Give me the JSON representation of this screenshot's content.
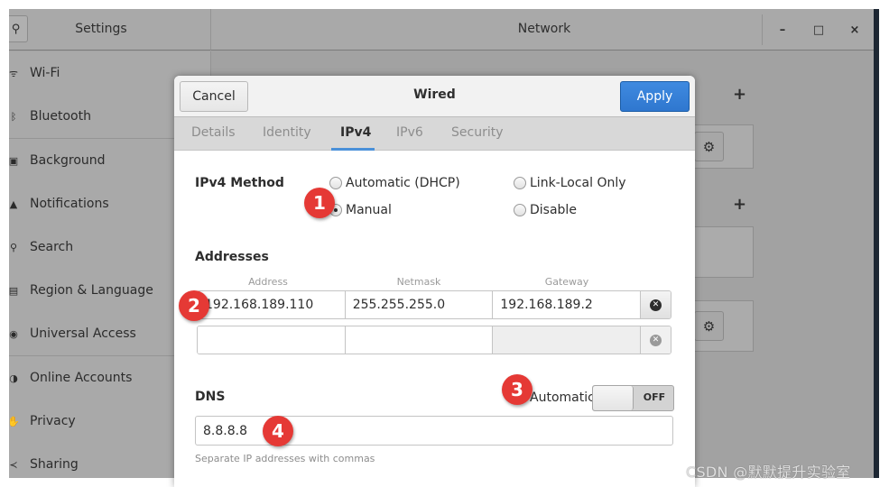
{
  "window": {
    "settings_title": "Settings",
    "panel_title": "Network",
    "controls": {
      "minimize": "–",
      "maximize": "□",
      "close": "×"
    },
    "search_icon": "⚲"
  },
  "sidebar": {
    "items": [
      {
        "label": "Wi-Fi",
        "icon": "wifi-icon",
        "glyph": "ᯤ"
      },
      {
        "label": "Bluetooth",
        "icon": "bluetooth-icon",
        "glyph": "ᛒ"
      },
      {
        "label": "Background",
        "icon": "background-icon",
        "glyph": "▣"
      },
      {
        "label": "Notifications",
        "icon": "bell-icon",
        "glyph": "▲"
      },
      {
        "label": "Search",
        "icon": "search-icon",
        "glyph": "⚲"
      },
      {
        "label": "Region & Language",
        "icon": "region-icon",
        "glyph": "▤"
      },
      {
        "label": "Universal Access",
        "icon": "accessibility-icon",
        "glyph": "◉"
      },
      {
        "label": "Online Accounts",
        "icon": "online-accounts-icon",
        "glyph": "◑"
      },
      {
        "label": "Privacy",
        "icon": "privacy-hand-icon",
        "glyph": "✋"
      },
      {
        "label": "Sharing",
        "icon": "share-icon",
        "glyph": "≺"
      }
    ]
  },
  "network_panel": {
    "add_glyph": "+",
    "gear_glyph": "⚙"
  },
  "dialog": {
    "title": "Wired",
    "cancel_label": "Cancel",
    "apply_label": "Apply",
    "accent_color": "#3584e4",
    "tabs": [
      {
        "label": "Details",
        "active": false
      },
      {
        "label": "Identity",
        "active": false
      },
      {
        "label": "IPv4",
        "active": true
      },
      {
        "label": "IPv6",
        "active": false
      },
      {
        "label": "Security",
        "active": false
      }
    ],
    "ipv4_method": {
      "label": "IPv4 Method",
      "options": [
        {
          "label": "Automatic (DHCP)",
          "checked": false
        },
        {
          "label": "Link-Local Only",
          "checked": false
        },
        {
          "label": "Manual",
          "checked": true
        },
        {
          "label": "Disable",
          "checked": false
        }
      ]
    },
    "addresses": {
      "label": "Addresses",
      "columns": [
        "Address",
        "Netmask",
        "Gateway"
      ],
      "rows": [
        {
          "address": "192.168.189.110",
          "netmask": "255.255.255.0",
          "gateway": "192.168.189.2"
        },
        {
          "address": "",
          "netmask": "",
          "gateway": ""
        }
      ],
      "delete_glyph": "✕"
    },
    "dns": {
      "label": "DNS",
      "automatic_label": "Automatic",
      "automatic_state": "OFF",
      "value": "8.8.8.8",
      "hint": "Separate IP addresses with commas"
    }
  },
  "annotations": [
    "1",
    "2",
    "3",
    "4"
  ],
  "watermark": "CSDN @默默提升实验室"
}
